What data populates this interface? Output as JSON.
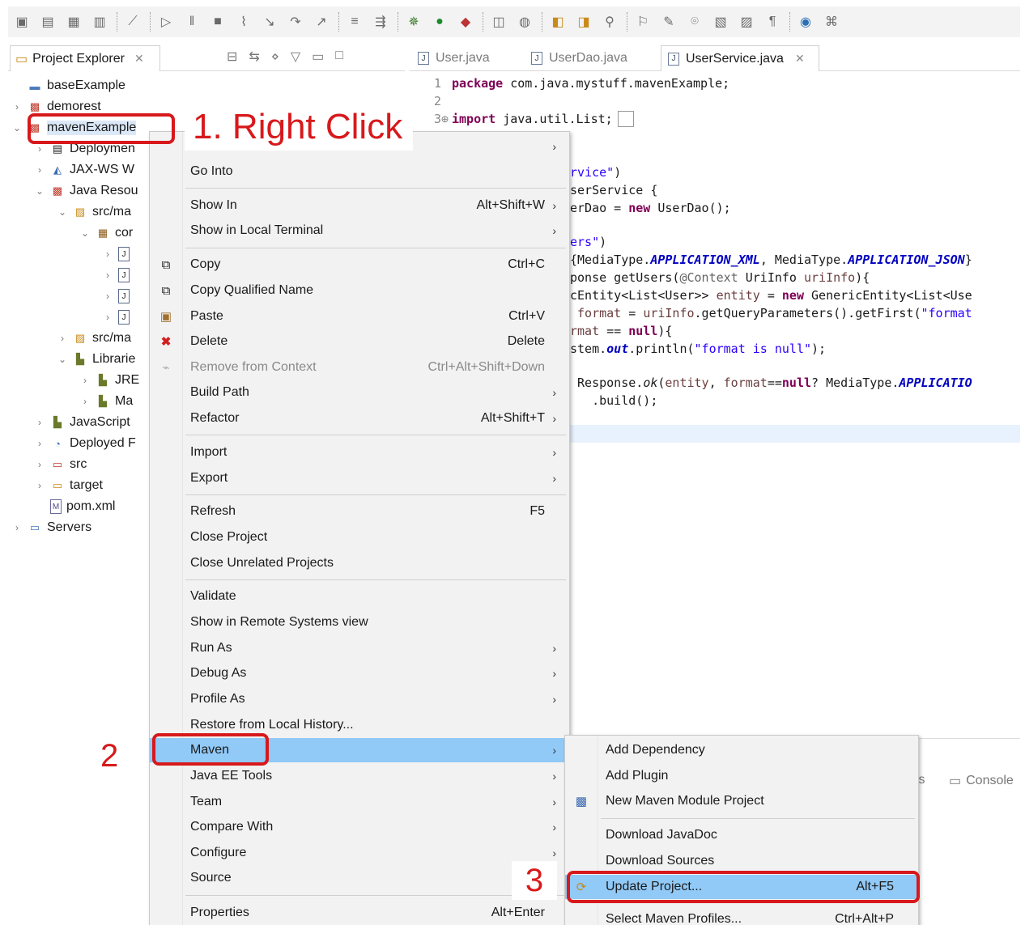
{
  "toolbar": {
    "icons": [
      "new-icon",
      "save-icon",
      "save-all-icon",
      "print-icon",
      "skip-breakpoints-icon",
      "resume-icon",
      "suspend-icon",
      "terminate-icon",
      "disconnect-icon",
      "step-into-icon",
      "step-over-icon",
      "step-return-icon",
      "drop-to-frame-icon",
      "use-step-filters-icon",
      "bug-icon",
      "run-icon",
      "external-tools-icon",
      "new-server-icon",
      "web-browser-icon",
      "new-java-project-icon",
      "open-type-icon",
      "search-icon",
      "globe-icon",
      "perspective-icon"
    ]
  },
  "project_explorer": {
    "tab_label": "Project Explorer",
    "tree": [
      {
        "label": "baseExample"
      },
      {
        "label": "demorest"
      },
      {
        "label": "mavenExample"
      },
      {
        "label": "Deploymen"
      },
      {
        "label": "JAX-WS W"
      },
      {
        "label": "Java Resou"
      },
      {
        "label": "src/ma"
      },
      {
        "label": "cor"
      },
      {
        "label": "src/ma"
      },
      {
        "label": "Librarie"
      },
      {
        "label": "JRE"
      },
      {
        "label": "Ma"
      },
      {
        "label": "JavaScript"
      },
      {
        "label": "Deployed F"
      },
      {
        "label": "src"
      },
      {
        "label": "target"
      },
      {
        "label": "pom.xml"
      },
      {
        "label": "Servers"
      }
    ]
  },
  "editor": {
    "tabs": [
      "User.java",
      "UserDao.java",
      "UserService.java"
    ],
    "active_tab": "UserService.java"
  },
  "context_menu": {
    "items": [
      {
        "label": "Go Into",
        "shortcut": ""
      },
      {
        "label": "Show In",
        "shortcut": "Alt+Shift+W"
      },
      {
        "label": "Show in Local Terminal",
        "shortcut": ""
      },
      {
        "label": "Copy",
        "shortcut": "Ctrl+C"
      },
      {
        "label": "Copy Qualified Name",
        "shortcut": ""
      },
      {
        "label": "Paste",
        "shortcut": "Ctrl+V"
      },
      {
        "label": "Delete",
        "shortcut": "Delete"
      },
      {
        "label": "Remove from Context",
        "shortcut": "Ctrl+Alt+Shift+Down"
      },
      {
        "label": "Build Path",
        "shortcut": ""
      },
      {
        "label": "Refactor",
        "shortcut": "Alt+Shift+T"
      },
      {
        "label": "Import",
        "shortcut": ""
      },
      {
        "label": "Export",
        "shortcut": ""
      },
      {
        "label": "Refresh",
        "shortcut": "F5"
      },
      {
        "label": "Close Project",
        "shortcut": ""
      },
      {
        "label": "Close Unrelated Projects",
        "shortcut": ""
      },
      {
        "label": "Validate",
        "shortcut": ""
      },
      {
        "label": "Show in Remote Systems view",
        "shortcut": ""
      },
      {
        "label": "Run As",
        "shortcut": ""
      },
      {
        "label": "Debug As",
        "shortcut": ""
      },
      {
        "label": "Profile As",
        "shortcut": ""
      },
      {
        "label": "Restore from Local History...",
        "shortcut": ""
      },
      {
        "label": "Maven",
        "shortcut": ""
      },
      {
        "label": "Java EE Tools",
        "shortcut": ""
      },
      {
        "label": "Team",
        "shortcut": ""
      },
      {
        "label": "Compare With",
        "shortcut": ""
      },
      {
        "label": "Configure",
        "shortcut": ""
      },
      {
        "label": "Source",
        "shortcut": ""
      },
      {
        "label": "Properties",
        "shortcut": "Alt+Enter"
      }
    ]
  },
  "maven_submenu": {
    "items": [
      {
        "label": "Add Dependency",
        "shortcut": ""
      },
      {
        "label": "Add Plugin",
        "shortcut": ""
      },
      {
        "label": "New Maven Module Project",
        "shortcut": ""
      },
      {
        "label": "Download JavaDoc",
        "shortcut": ""
      },
      {
        "label": "Download Sources",
        "shortcut": ""
      },
      {
        "label": "Update Project...",
        "shortcut": "Alt+F5"
      },
      {
        "label": "Select Maven Profiles...",
        "shortcut": "Ctrl+Alt+P"
      }
    ]
  },
  "bottom_panel": {
    "partial_tab": "ts",
    "console_label": "Console"
  },
  "annotations": {
    "step1": "1. Right Click",
    "step2": "2",
    "step3": "3"
  },
  "colors": {
    "highlight": "#91c9f7",
    "annotation_red": "#d7191c",
    "keyword": "#7f0055",
    "string": "#2a00ff"
  }
}
